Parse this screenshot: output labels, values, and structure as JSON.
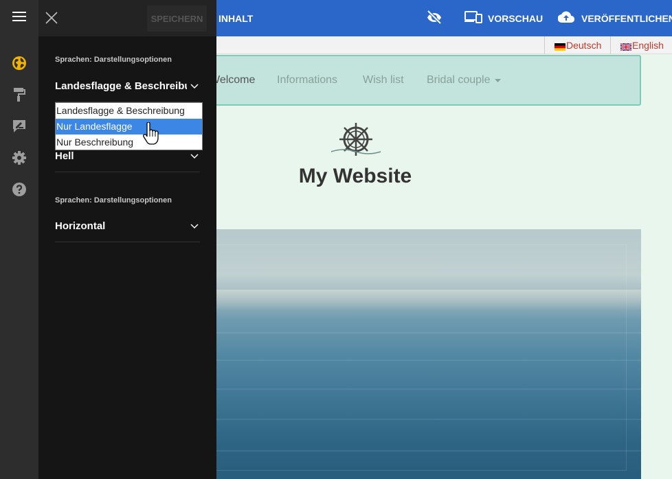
{
  "toolbar": {
    "close_label": "×",
    "save_label": "SPEICHERN",
    "content_label": "INHALT",
    "preview_label": "VORSCHAU",
    "publish_label": "VERÖFFENTLICHEN"
  },
  "sidebar_icons": [
    "globe-icon",
    "paint-roller-icon",
    "edit-icon",
    "gear-icon",
    "help-icon"
  ],
  "panel": {
    "section1_label": "Sprachen: Darstellungsoptionen",
    "select1_value": "Landesflagge & Beschreibung",
    "select2_value": "Hell",
    "section2_label": "Sprachen: Darstellungsoptionen",
    "select3_value": "Horizontal"
  },
  "dropdown": {
    "options": [
      "Landesflagge & Beschreibung",
      "Nur Landesflagge",
      "Nur Beschreibung"
    ],
    "selected_index": 1
  },
  "languages": [
    {
      "label": "Deutsch",
      "flag": "de-flag"
    },
    {
      "label": "English",
      "flag": "uk-flag"
    }
  ],
  "site": {
    "nav": [
      "Welcome",
      "Informations",
      "Wish list",
      "Bridal couple"
    ],
    "title": "My Website"
  },
  "colors": {
    "toolbar": "#2b66c9",
    "panel": "#151515",
    "rail": "#2d2d2d",
    "accent_icon": "#f0b400",
    "dropdown_selected": "#3c87e6",
    "nav_bg": "#c3e4dc",
    "page_bg": "#e8f6ee",
    "language_text": "#c0392b"
  }
}
